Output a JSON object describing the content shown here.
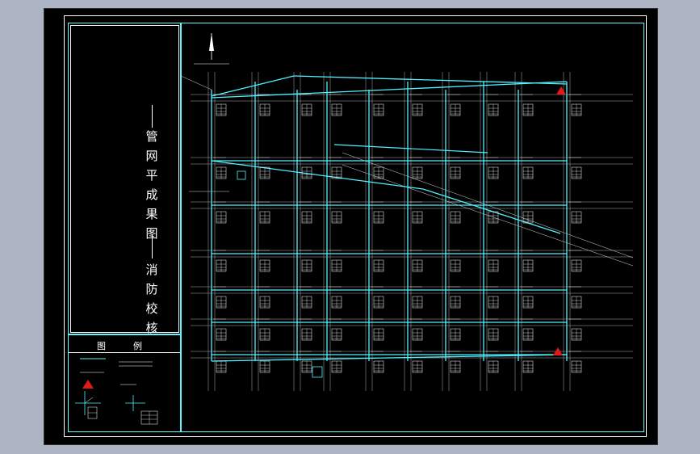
{
  "drawing": {
    "title_part1": "管网平成果图",
    "title_part2": "消防校核"
  },
  "legend": {
    "heading_left": "图",
    "heading_right": "例"
  },
  "colors": {
    "pipe": "#4ff2ff",
    "road": "#d9d9d9",
    "hydrant": "#e31818",
    "frame": "#ffffff",
    "background": "#000000"
  }
}
